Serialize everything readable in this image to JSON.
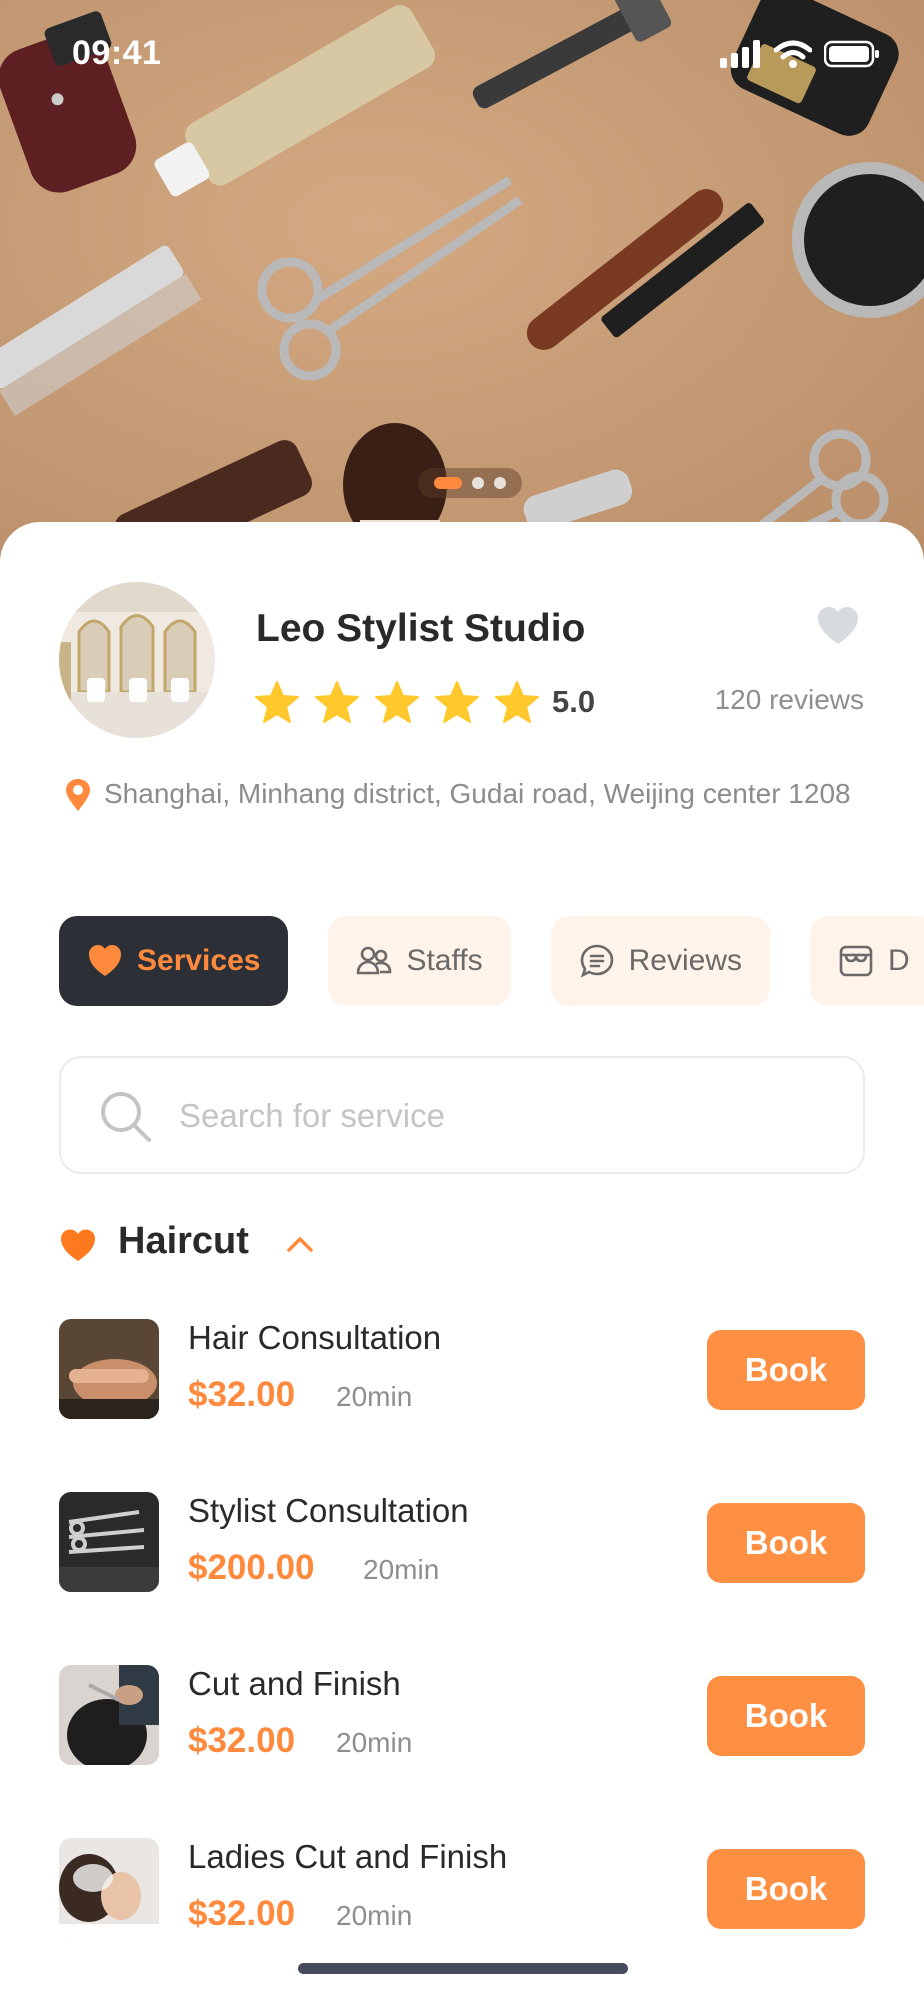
{
  "status_bar": {
    "time": "09:41"
  },
  "hero": {
    "dots_count": 3,
    "active_dot": 0
  },
  "studio": {
    "name": "Leo Stylist Studio",
    "rating": "5.0",
    "stars": 5,
    "reviews": "120 reviews",
    "address": "Shanghai, Minhang district, Gudai road, Weijing center 1208"
  },
  "tabs": [
    {
      "label": "Services",
      "icon": "heart-icon",
      "active": true
    },
    {
      "label": "Staffs",
      "icon": "people-icon",
      "active": false
    },
    {
      "label": "Reviews",
      "icon": "chat-icon",
      "active": false
    },
    {
      "label": "D",
      "icon": "shop-icon",
      "active": false
    }
  ],
  "search": {
    "placeholder": "Search for service",
    "value": ""
  },
  "category": {
    "title": "Haircut",
    "icon": "heart-icon",
    "expanded": true
  },
  "services": [
    {
      "name": "Hair Consultation",
      "price": "$32.00",
      "duration": "20min",
      "book_label": "Book"
    },
    {
      "name": "Stylist Consultation",
      "price": "$200.00",
      "duration": "20min",
      "book_label": "Book"
    },
    {
      "name": "Cut and Finish",
      "price": "$32.00",
      "duration": "20min",
      "book_label": "Book"
    },
    {
      "name": "Ladies Cut and Finish",
      "price": "$32.00",
      "duration": "20min",
      "book_label": "Book"
    }
  ],
  "colors": {
    "accent": "#ff8a3d",
    "tab_active_bg": "#2c3036",
    "tab_bg": "#fff3ea",
    "star": "#ffc82c",
    "hero_bg": "#c49a74"
  }
}
